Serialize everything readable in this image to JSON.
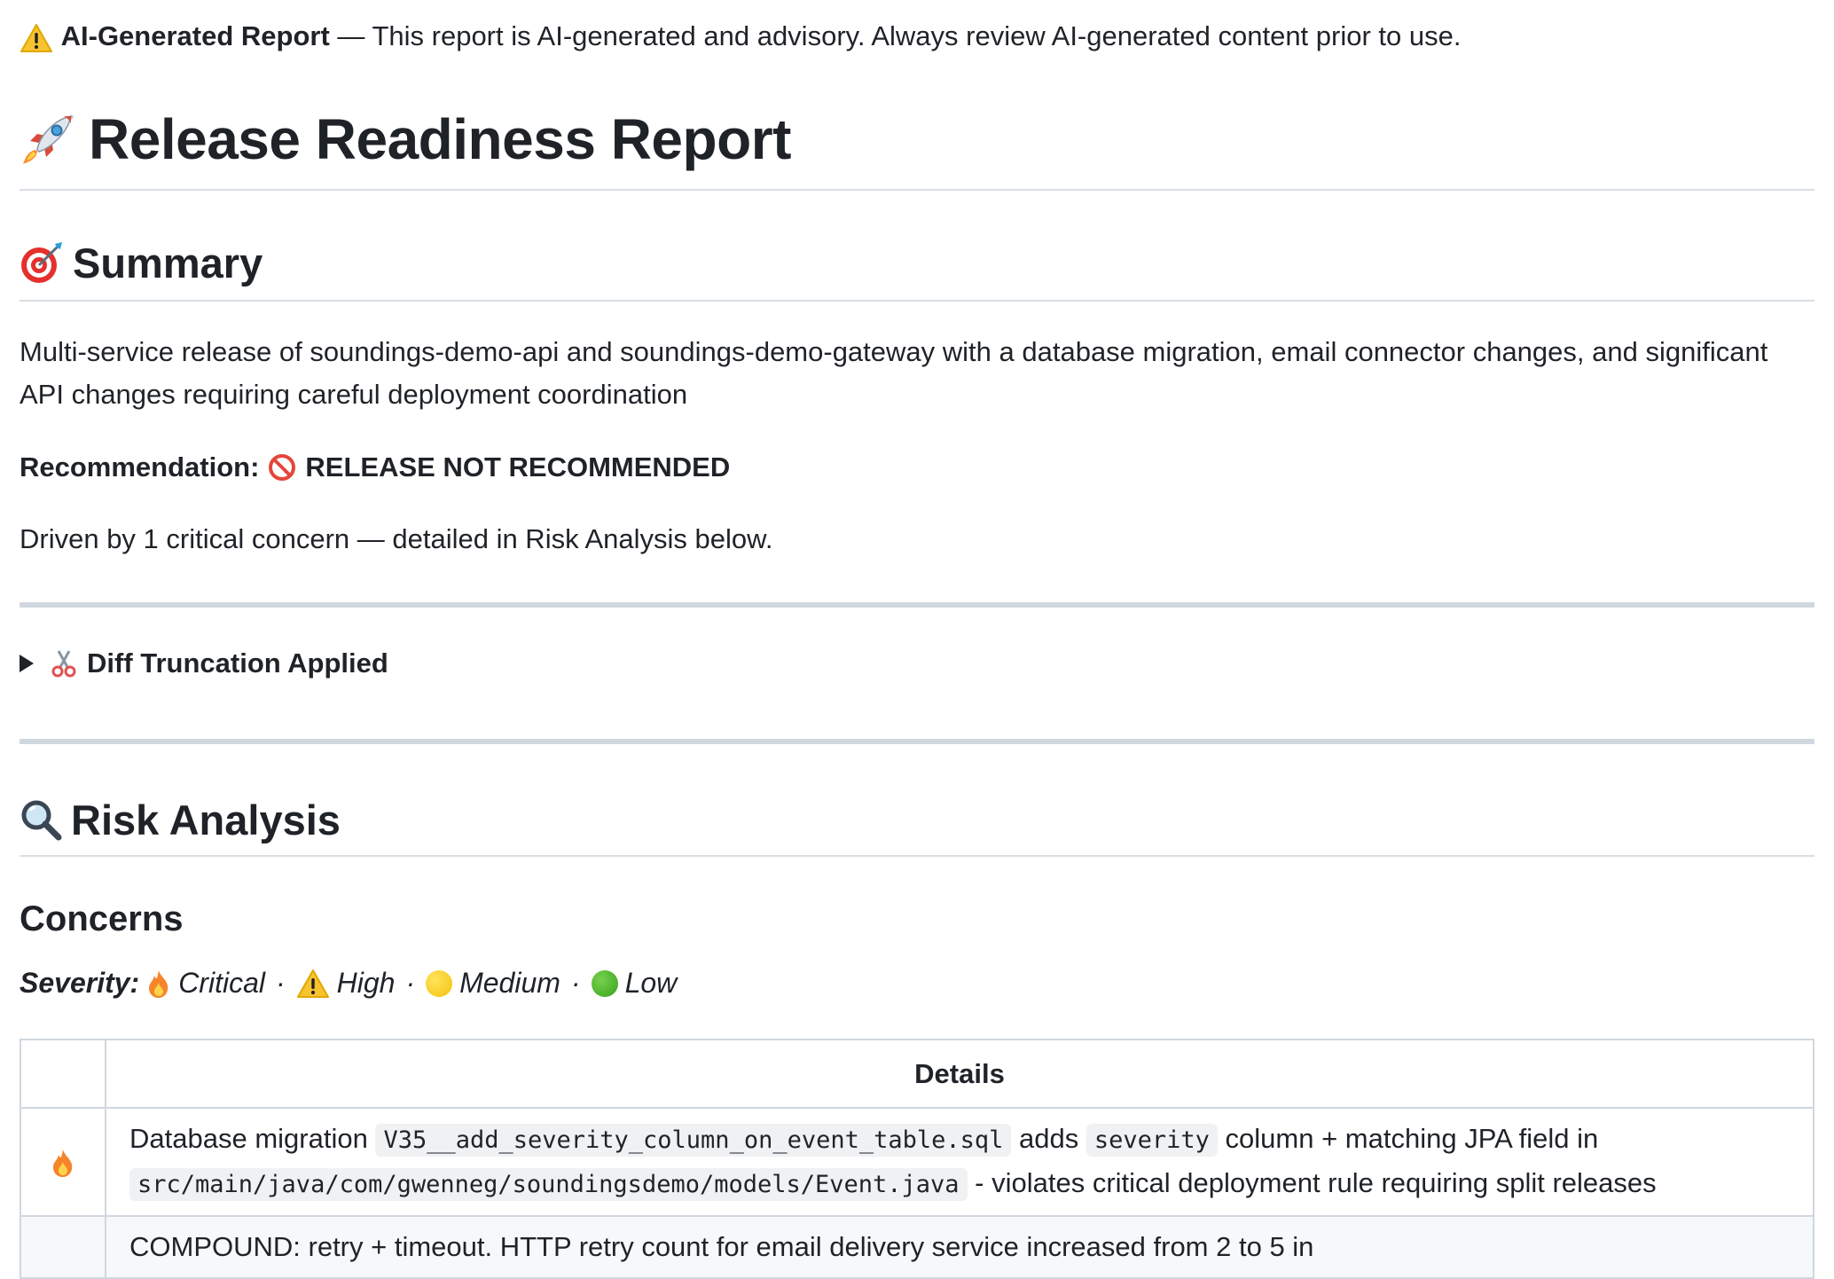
{
  "banner": {
    "label": "AI-Generated Report",
    "text": " — This report is AI-generated and advisory. Always review AI-generated content prior to use."
  },
  "title": "Release Readiness Report",
  "summary": {
    "heading": "Summary",
    "description": "Multi-service release of soundings-demo-api and soundings-demo-gateway with a database migration, email connector changes, and significant API changes requiring careful deployment coordination",
    "recommendation_label": "Recommendation:",
    "recommendation_value": "RELEASE NOT RECOMMENDED",
    "driver_text": "Driven by 1 critical concern — detailed in Risk Analysis below."
  },
  "truncation": {
    "label": "Diff Truncation Applied"
  },
  "risk": {
    "heading": "Risk Analysis",
    "concerns_heading": "Concerns",
    "legend": {
      "label": "Severity:",
      "critical": "Critical",
      "high": "High",
      "medium": "Medium",
      "low": "Low"
    },
    "table": {
      "header_details": "Details",
      "rows": [
        {
          "severity_icon": "fire-icon",
          "t1": "Database migration ",
          "c1": "V35__add_severity_column_on_event_table.sql",
          "t2": " adds ",
          "c2": "severity",
          "t3": " column + matching JPA field in ",
          "c3": "src/main/java/com/gwenneg/soundingsdemo/models/Event.java",
          "t4": " - violates critical deployment rule requiring split releases"
        },
        {
          "severity_icon": "",
          "t1": "COMPOUND: retry + timeout. HTTP retry count for email delivery service increased from 2 to 5 in"
        }
      ]
    }
  },
  "colors": {
    "text": "#1f2328",
    "rule": "#d0d7de",
    "code_bg": "#eff1f3",
    "alt_row": "#f6f8fa"
  }
}
